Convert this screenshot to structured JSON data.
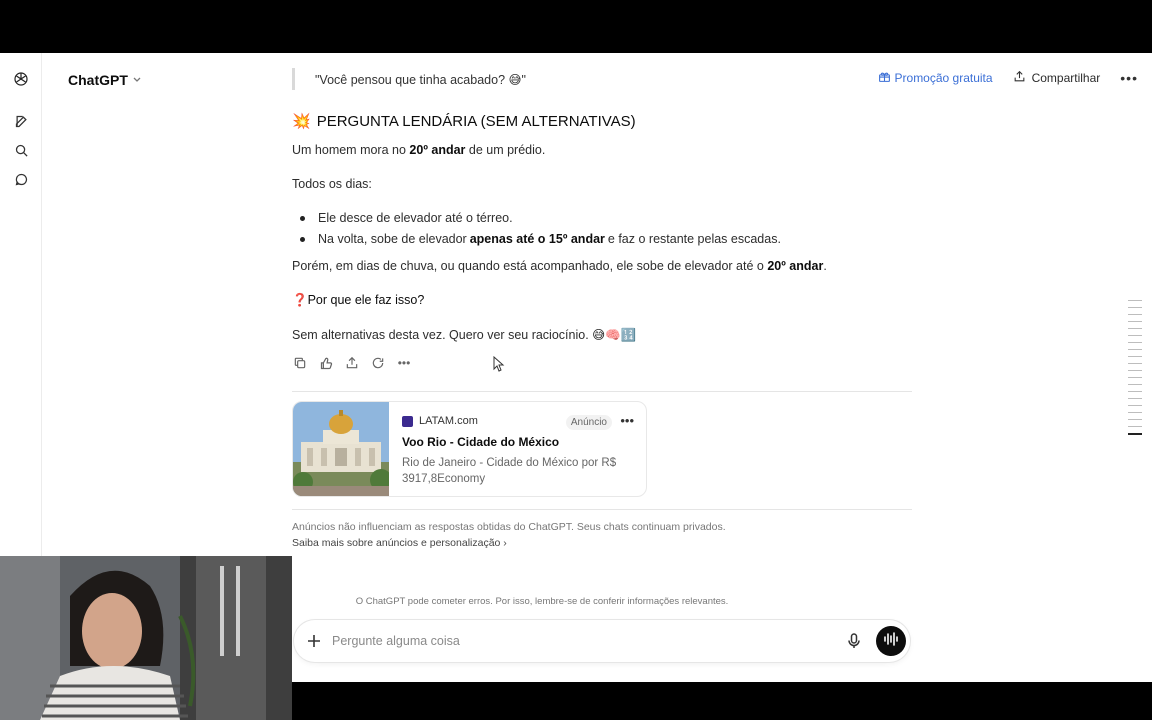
{
  "header": {
    "model_name": "ChatGPT",
    "promo_label": "Promoção gratuita",
    "share_label": "Compartilhar"
  },
  "quote": {
    "text": "\"Você pensou que tinha acabado? 😅\""
  },
  "message": {
    "heading_emoji": "💥",
    "heading": "PERGUNTA LENDÁRIA (SEM ALTERNATIVAS)",
    "p1_pre": "Um homem mora no",
    "p1_bold": "20º andar",
    "p1_post": "de um prédio.",
    "p2": "Todos os dias:",
    "bullet1": "Ele desce de elevador até o térreo.",
    "bullet2_pre": "Na volta, sobe de elevador",
    "bullet2_bold": "apenas até o 15º andar",
    "bullet2_post": "e faz o restante pelas escadas.",
    "p3_pre": "Porém, em dias de chuva, ou quando está acompanhado, ele sobe de elevador até o",
    "p3_bold": "20º andar",
    "p3_post": ".",
    "question_emoji": "❓",
    "question": "Por que ele faz isso?",
    "closing": "Sem alternativas desta vez. Quero ver seu raciocínio. 😅🧠🔢"
  },
  "ad": {
    "source": "LATAM.com",
    "badge": "Anúncio",
    "title": "Voo Rio - Cidade do México",
    "description": "Rio de Janeiro - Cidade do México por R$ 3917,8Economy"
  },
  "disclaimer": "Anúncios não influenciam as respostas obtidas do ChatGPT. Seus chats continuam privados.",
  "learn_more": "Saiba mais sobre anúncios e personalização",
  "footnote": "O ChatGPT pode cometer erros. Por isso, lembre-se de conferir informações relevantes.",
  "composer": {
    "placeholder": "Pergunte alguma coisa",
    "value": ""
  },
  "colors": {
    "accent_link": "#3b6fd6",
    "voice_button": "#0d0d0d"
  }
}
